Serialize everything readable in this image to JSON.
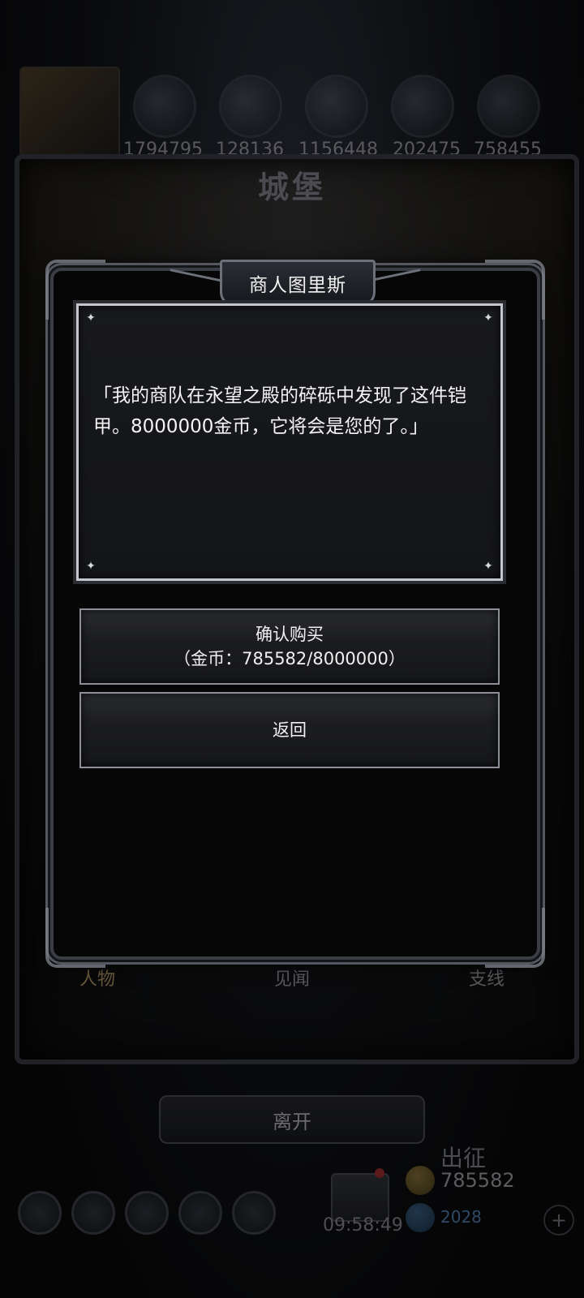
{
  "background": {
    "resources": [
      "1794795",
      "128136",
      "1156448",
      "202475",
      "758455"
    ],
    "castle_title": "城堡",
    "tabs": [
      "人物",
      "见闻",
      "支线"
    ],
    "leave_label": "离开",
    "sortie_label": "出征",
    "gold_amount": "785582",
    "gem_amount": "2028",
    "timer": "09:58:49",
    "plus_label": "+"
  },
  "dialog": {
    "title": "商人图里斯",
    "message": "「我的商队在永望之殿的碎砾中发现了这件铠甲。8000000金币，它将会是您的了。」",
    "confirm_label": "确认购买",
    "confirm_cost": "（金币：785582/8000000）",
    "return_label": "返回"
  },
  "colors": {
    "dialog_border": "#c4c6cc",
    "panel_bg": "#18191d",
    "text": "#f4f4f4"
  }
}
